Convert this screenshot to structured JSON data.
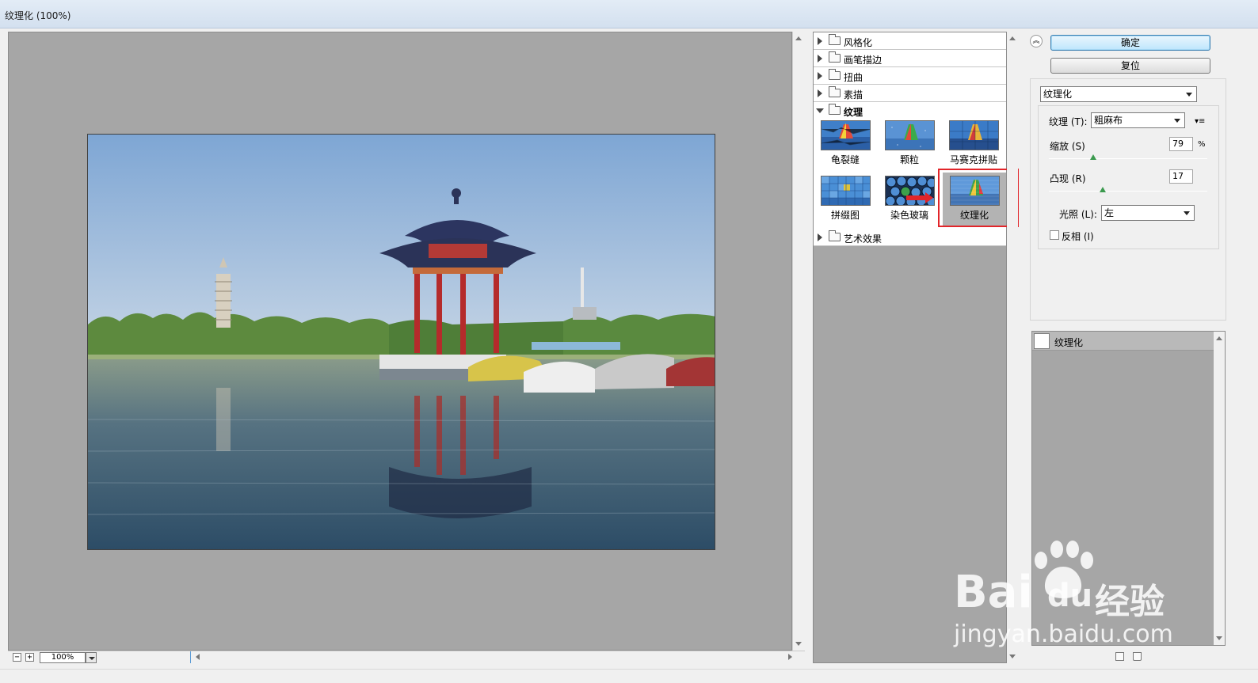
{
  "window": {
    "title": "纹理化 (100%)"
  },
  "preview": {
    "zoom": "100%",
    "zoom_out": "−",
    "zoom_in": "+"
  },
  "gallery": {
    "categories": [
      {
        "label": "风格化",
        "expanded": false
      },
      {
        "label": "画笔描边",
        "expanded": false
      },
      {
        "label": "扭曲",
        "expanded": false
      },
      {
        "label": "素描",
        "expanded": false
      },
      {
        "label": "纹理",
        "expanded": true
      },
      {
        "label": "艺术效果",
        "expanded": false
      }
    ],
    "texture_filters": [
      {
        "label": "龟裂缝"
      },
      {
        "label": "颗粒"
      },
      {
        "label": "马赛克拼贴"
      },
      {
        "label": "拼缀图"
      },
      {
        "label": "染色玻璃"
      },
      {
        "label": "纹理化",
        "selected": true
      }
    ]
  },
  "actions": {
    "ok_label": "确定",
    "reset_label": "复位"
  },
  "settings": {
    "filter_select": "纹理化",
    "texture_label": "纹理 (T):",
    "texture_value": "粗麻布",
    "scale_label": "缩放 (S)",
    "scale_value": "79",
    "scale_unit": "%",
    "scale_fraction": 0.28,
    "relief_label": "凸现 (R)",
    "relief_value": "17",
    "relief_fraction": 0.34,
    "light_label": "光照 (L):",
    "light_value": "左",
    "invert_label": "反相 (I)",
    "invert_checked": false
  },
  "layers": {
    "items": [
      {
        "label": "纹理化"
      }
    ]
  },
  "watermark": {
    "brand": "Bai",
    "brand2": "du",
    "cn": "经验",
    "url": "jingyan.baidu.com"
  },
  "colors": {
    "selection_outline": "#e2252a",
    "knob": "#3c9a4f",
    "primary_button": "#bee6fd"
  }
}
